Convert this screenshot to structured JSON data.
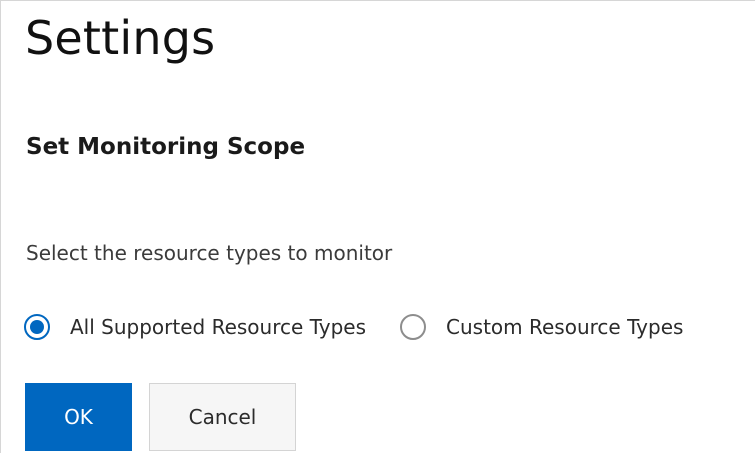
{
  "page": {
    "title": "Settings"
  },
  "section": {
    "title": "Set Monitoring Scope",
    "prompt": "Select the resource types to monitor"
  },
  "resource_types": {
    "options": [
      {
        "label": "All Supported Resource Types",
        "selected": true
      },
      {
        "label": "Custom Resource Types",
        "selected": false
      }
    ]
  },
  "actions": {
    "ok_label": "OK",
    "cancel_label": "Cancel"
  },
  "colors": {
    "accent": "#0067c0",
    "cancel_bg": "#f6f6f6"
  }
}
